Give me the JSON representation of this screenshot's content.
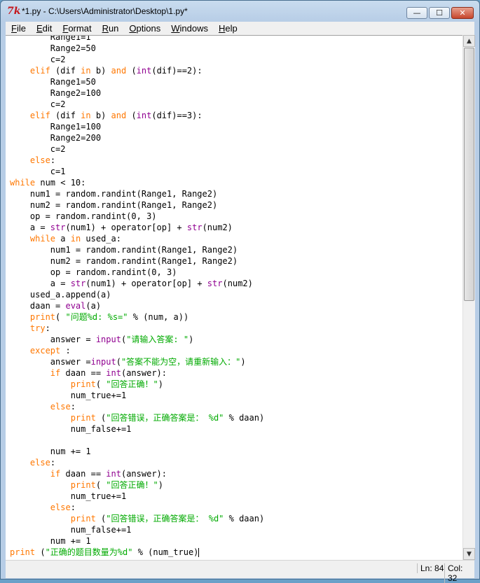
{
  "window": {
    "title": "*1.py - C:\\Users\\Administrator\\Desktop\\1.py*",
    "icon": "python-idle-icon",
    "controls": {
      "minimize": "—",
      "maximize": "☐",
      "close": "✕"
    }
  },
  "menu": {
    "items": [
      {
        "label": "File",
        "u": "F",
        "rest": "ile"
      },
      {
        "label": "Edit",
        "u": "E",
        "rest": "dit"
      },
      {
        "label": "Format",
        "u": "F",
        "rest": "ormat"
      },
      {
        "label": "Run",
        "u": "R",
        "rest": "un"
      },
      {
        "label": "Options",
        "u": "O",
        "rest": "ptions"
      },
      {
        "label": "Windows",
        "u": "W",
        "rest": "indows"
      },
      {
        "label": "Help",
        "u": "H",
        "rest": "elp"
      }
    ]
  },
  "status": {
    "line": "Ln: 84",
    "col": "Col: 32"
  },
  "colors": {
    "keyword": "#ff7700",
    "builtin": "#900090",
    "string": "#00aa00"
  },
  "code_lines": [
    [
      [
        "        Range1=1",
        ""
      ]
    ],
    [
      [
        "        Range2=50",
        ""
      ]
    ],
    [
      [
        "        c=2",
        ""
      ]
    ],
    [
      [
        "    ",
        ""
      ],
      [
        "elif",
        "kw"
      ],
      [
        " (dif ",
        ""
      ],
      [
        "in",
        "kw"
      ],
      [
        " b) ",
        ""
      ],
      [
        "and",
        "kw"
      ],
      [
        " (",
        ""
      ],
      [
        "int",
        "bi"
      ],
      [
        "(dif)==2):",
        ""
      ]
    ],
    [
      [
        "        Range1=50",
        ""
      ]
    ],
    [
      [
        "        Range2=100",
        ""
      ]
    ],
    [
      [
        "        c=2",
        ""
      ]
    ],
    [
      [
        "    ",
        ""
      ],
      [
        "elif",
        "kw"
      ],
      [
        " (dif ",
        ""
      ],
      [
        "in",
        "kw"
      ],
      [
        " b) ",
        ""
      ],
      [
        "and",
        "kw"
      ],
      [
        " (",
        ""
      ],
      [
        "int",
        "bi"
      ],
      [
        "(dif)==3):",
        ""
      ]
    ],
    [
      [
        "        Range1=100",
        ""
      ]
    ],
    [
      [
        "        Range2=200",
        ""
      ]
    ],
    [
      [
        "        c=2",
        ""
      ]
    ],
    [
      [
        "    ",
        ""
      ],
      [
        "else",
        "kw"
      ],
      [
        ":",
        ""
      ]
    ],
    [
      [
        "        c=1",
        ""
      ]
    ],
    [
      [
        "while",
        "kw"
      ],
      [
        " num < 10:",
        ""
      ]
    ],
    [
      [
        "    num1 = random.randint(Range1, Range2)",
        ""
      ]
    ],
    [
      [
        "    num2 = random.randint(Range1, Range2)",
        ""
      ]
    ],
    [
      [
        "    op = random.randint(0, 3)",
        ""
      ]
    ],
    [
      [
        "    a = ",
        ""
      ],
      [
        "str",
        "bi"
      ],
      [
        "(num1) + operator[op] + ",
        ""
      ],
      [
        "str",
        "bi"
      ],
      [
        "(num2)",
        ""
      ]
    ],
    [
      [
        "    ",
        ""
      ],
      [
        "while",
        "kw"
      ],
      [
        " a ",
        ""
      ],
      [
        "in",
        "kw"
      ],
      [
        " used_a:",
        ""
      ]
    ],
    [
      [
        "        num1 = random.randint(Range1, Range2)",
        ""
      ]
    ],
    [
      [
        "        num2 = random.randint(Range1, Range2)",
        ""
      ]
    ],
    [
      [
        "        op = random.randint(0, 3)",
        ""
      ]
    ],
    [
      [
        "        a = ",
        ""
      ],
      [
        "str",
        "bi"
      ],
      [
        "(num1) + operator[op] + ",
        ""
      ],
      [
        "str",
        "bi"
      ],
      [
        "(num2)",
        ""
      ]
    ],
    [
      [
        "    used_a.append(a)",
        ""
      ]
    ],
    [
      [
        "    daan = ",
        ""
      ],
      [
        "eval",
        "bi"
      ],
      [
        "(a)",
        ""
      ]
    ],
    [
      [
        "    ",
        ""
      ],
      [
        "print",
        "kw"
      ],
      [
        "( ",
        ""
      ],
      [
        "\"问题%d: %s=\"",
        "st"
      ],
      [
        " % (num, a))",
        ""
      ]
    ],
    [
      [
        "    ",
        ""
      ],
      [
        "try",
        "kw"
      ],
      [
        ":",
        ""
      ]
    ],
    [
      [
        "        answer = ",
        ""
      ],
      [
        "input",
        "bi"
      ],
      [
        "(",
        ""
      ],
      [
        "\"请输入答案: \"",
        "st"
      ],
      [
        ")",
        ""
      ]
    ],
    [
      [
        "    ",
        ""
      ],
      [
        "except",
        "kw"
      ],
      [
        " :",
        ""
      ]
    ],
    [
      [
        "        answer =",
        ""
      ],
      [
        "input",
        "bi"
      ],
      [
        "(",
        ""
      ],
      [
        "\"答案不能为空，请重新输入：\"",
        "st"
      ],
      [
        ")",
        ""
      ]
    ],
    [
      [
        "        ",
        ""
      ],
      [
        "if",
        "kw"
      ],
      [
        " daan == ",
        ""
      ],
      [
        "int",
        "bi"
      ],
      [
        "(answer):",
        ""
      ]
    ],
    [
      [
        "            ",
        ""
      ],
      [
        "print",
        "kw"
      ],
      [
        "( ",
        ""
      ],
      [
        "\"回答正确！\"",
        "st"
      ],
      [
        ")",
        ""
      ]
    ],
    [
      [
        "            num_true+=1",
        ""
      ]
    ],
    [
      [
        "        ",
        ""
      ],
      [
        "else",
        "kw"
      ],
      [
        ":",
        ""
      ]
    ],
    [
      [
        "            ",
        ""
      ],
      [
        "print",
        "kw"
      ],
      [
        " (",
        ""
      ],
      [
        "\"回答错误，正确答案是： %d\"",
        "st"
      ],
      [
        " % daan)",
        ""
      ]
    ],
    [
      [
        "            num_false+=1",
        ""
      ]
    ],
    [
      [
        "",
        ""
      ]
    ],
    [
      [
        "        num += 1",
        ""
      ]
    ],
    [
      [
        "    ",
        ""
      ],
      [
        "else",
        "kw"
      ],
      [
        ":",
        ""
      ]
    ],
    [
      [
        "        ",
        ""
      ],
      [
        "if",
        "kw"
      ],
      [
        " daan == ",
        ""
      ],
      [
        "int",
        "bi"
      ],
      [
        "(answer):",
        ""
      ]
    ],
    [
      [
        "            ",
        ""
      ],
      [
        "print",
        "kw"
      ],
      [
        "( ",
        ""
      ],
      [
        "\"回答正确！\"",
        "st"
      ],
      [
        ")",
        ""
      ]
    ],
    [
      [
        "            num_true+=1",
        ""
      ]
    ],
    [
      [
        "        ",
        ""
      ],
      [
        "else",
        "kw"
      ],
      [
        ":",
        ""
      ]
    ],
    [
      [
        "            ",
        ""
      ],
      [
        "print",
        "kw"
      ],
      [
        " (",
        ""
      ],
      [
        "\"回答错误，正确答案是： %d\"",
        "st"
      ],
      [
        " % daan)",
        ""
      ]
    ],
    [
      [
        "            num_false+=1",
        ""
      ]
    ],
    [
      [
        "        num += 1",
        ""
      ]
    ],
    [
      [
        "print",
        "kw"
      ],
      [
        " (",
        ""
      ],
      [
        "\"正确的题目数量为%d\"",
        "st"
      ],
      [
        " % (num_true)",
        ""
      ]
    ]
  ]
}
